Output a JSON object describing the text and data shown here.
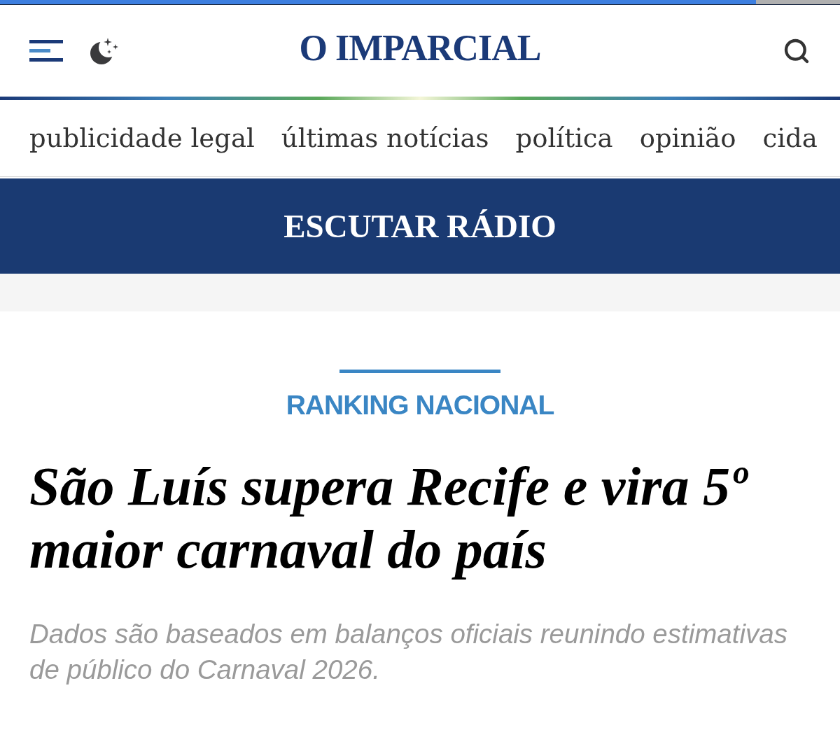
{
  "progress_bar": {
    "level": 0.9
  },
  "header": {
    "logo": "O IMPARCIAL"
  },
  "nav": {
    "items": [
      "publicidade legal",
      "últimas notícias",
      "política",
      "opinião",
      "cida"
    ]
  },
  "radio_banner": {
    "label": "ESCUTAR RÁDIO"
  },
  "article": {
    "category": "RANKING NACIONAL",
    "headline": "São Luís supera Recife e vira 5º maior carnaval do país",
    "subtitle": "Dados são baseados em balanços oficiais reunindo estimativas de público do Carnaval 2026."
  }
}
